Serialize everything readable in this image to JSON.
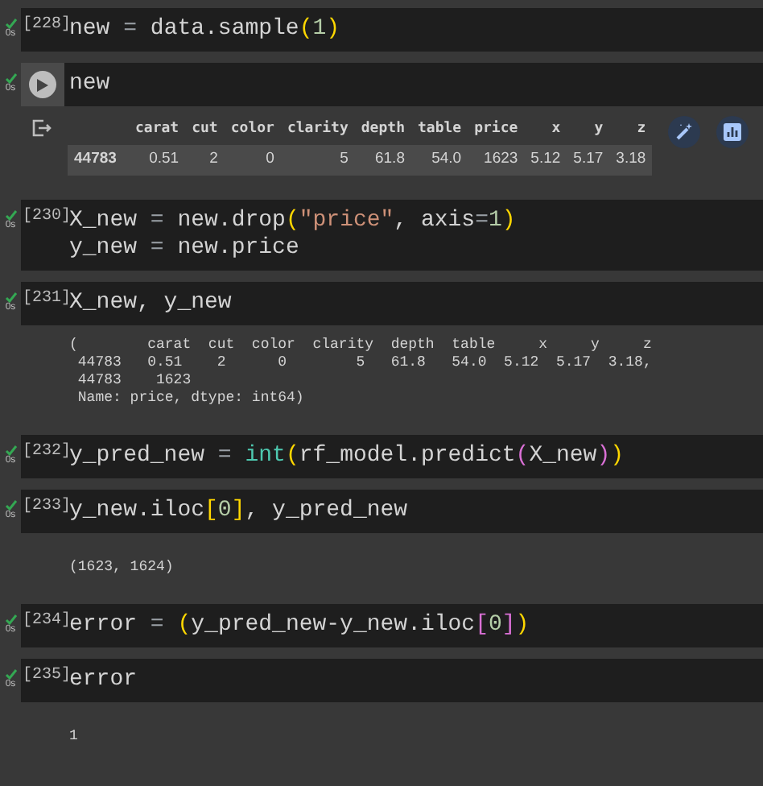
{
  "cells": [
    {
      "execution_count": "[228]",
      "hovered": false,
      "done": true,
      "duration": "0s",
      "code": [
        [
          {
            "t": "new ",
            "kind": "plain"
          },
          {
            "t": "=",
            "kind": "op"
          },
          {
            "t": " data.sample",
            "kind": "plain"
          },
          {
            "t": "(",
            "kind": "paren1"
          },
          {
            "t": "1",
            "kind": "num"
          },
          {
            "t": ")",
            "kind": "paren1"
          }
        ]
      ]
    },
    {
      "hovered": true,
      "done": true,
      "duration": "0s",
      "code": [
        [
          {
            "t": "new",
            "kind": "plain"
          }
        ]
      ],
      "output": {
        "kind": "dataframe",
        "columns": [
          "carat",
          "cut",
          "color",
          "clarity",
          "depth",
          "table",
          "price",
          "x",
          "y",
          "z"
        ],
        "rows": [
          {
            "index": "44783",
            "cells": [
              "0.51",
              "2",
              "0",
              "5",
              "61.8",
              "54.0",
              "1623",
              "5.12",
              "5.17",
              "3.18"
            ]
          }
        ]
      }
    },
    {
      "execution_count": "[230]",
      "hovered": false,
      "done": true,
      "duration": "0s",
      "code": [
        [
          {
            "t": "X_new ",
            "kind": "plain"
          },
          {
            "t": "=",
            "kind": "op"
          },
          {
            "t": " new.drop",
            "kind": "plain"
          },
          {
            "t": "(",
            "kind": "paren1"
          },
          {
            "t": "\"price\"",
            "kind": "str"
          },
          {
            "t": ", axis",
            "kind": "plain"
          },
          {
            "t": "=",
            "kind": "op"
          },
          {
            "t": "1",
            "kind": "num"
          },
          {
            "t": ")",
            "kind": "paren1"
          }
        ],
        [
          {
            "t": "y_new ",
            "kind": "plain"
          },
          {
            "t": "=",
            "kind": "op"
          },
          {
            "t": " new.price",
            "kind": "plain"
          }
        ]
      ]
    },
    {
      "execution_count": "[231]",
      "hovered": false,
      "done": true,
      "duration": "0s",
      "code": [
        [
          {
            "t": "X_new, y_new",
            "kind": "plain"
          }
        ]
      ],
      "output": {
        "kind": "text",
        "lines": [
          "(        carat  cut  color  clarity  depth  table     x     y     z",
          " 44783   0.51    2      0        5   61.8   54.0  5.12  5.17  3.18,",
          " 44783    1623",
          " Name: price, dtype: int64)"
        ]
      }
    },
    {
      "execution_count": "[232]",
      "hovered": false,
      "done": true,
      "duration": "0s",
      "code": [
        [
          {
            "t": "y_pred_new ",
            "kind": "plain"
          },
          {
            "t": "= ",
            "kind": "op"
          },
          {
            "t": "int",
            "kind": "builtin"
          },
          {
            "t": "(",
            "kind": "paren1"
          },
          {
            "t": "rf_model.predict",
            "kind": "plain"
          },
          {
            "t": "(",
            "kind": "paren2"
          },
          {
            "t": "X_new",
            "kind": "plain"
          },
          {
            "t": ")",
            "kind": "paren2"
          },
          {
            "t": ")",
            "kind": "paren1"
          }
        ]
      ]
    },
    {
      "execution_count": "[233]",
      "hovered": false,
      "done": true,
      "duration": "0s",
      "code": [
        [
          {
            "t": "y_new.iloc",
            "kind": "plain"
          },
          {
            "t": "[",
            "kind": "paren1"
          },
          {
            "t": "0",
            "kind": "num"
          },
          {
            "t": "]",
            "kind": "paren1"
          },
          {
            "t": ", y_pred_new",
            "kind": "plain"
          }
        ]
      ],
      "output": {
        "kind": "text",
        "lines": [
          "(1623, 1624)"
        ]
      }
    },
    {
      "execution_count": "[234]",
      "hovered": false,
      "done": true,
      "duration": "0s",
      "code": [
        [
          {
            "t": "error ",
            "kind": "plain"
          },
          {
            "t": "= ",
            "kind": "op"
          },
          {
            "t": "(",
            "kind": "paren1"
          },
          {
            "t": "y_pred_new-y_new.iloc",
            "kind": "plain"
          },
          {
            "t": "[",
            "kind": "paren2"
          },
          {
            "t": "0",
            "kind": "num"
          },
          {
            "t": "]",
            "kind": "paren2"
          },
          {
            "t": ")",
            "kind": "paren1"
          }
        ]
      ]
    },
    {
      "execution_count": "[235]",
      "hovered": false,
      "done": true,
      "duration": "0s",
      "code": [
        [
          {
            "t": "error",
            "kind": "plain"
          }
        ]
      ],
      "output": {
        "kind": "text",
        "lines": [
          "1"
        ]
      }
    }
  ]
}
